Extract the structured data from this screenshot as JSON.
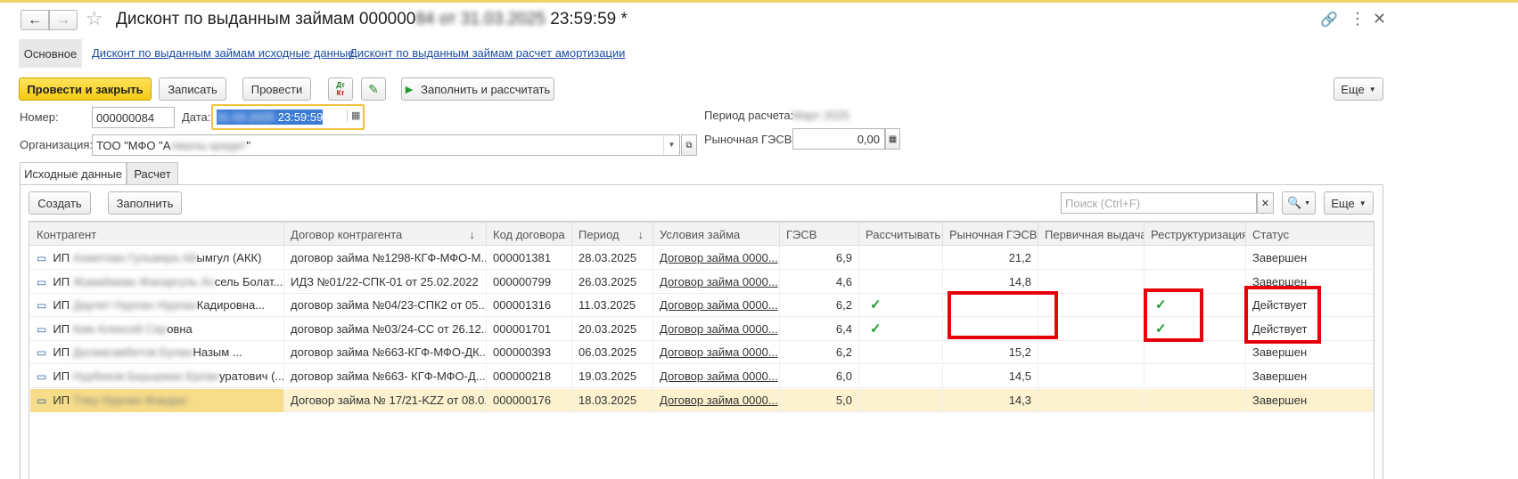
{
  "window": {
    "title_prefix": "Дисконт по выданным займам 000000",
    "title_blur": "84 от 31.03.2025",
    "title_suffix": " 23:59:59 *",
    "back_icon": "arrow-left-icon",
    "forward_icon": "arrow-right-icon",
    "star_icon": "star-icon",
    "link_icon": "link-icon",
    "more_icon": "kebab-icon",
    "close_icon": "close-icon"
  },
  "nav": {
    "main": "Основное",
    "link1": "Дисконт по выданным займам исходные данные",
    "link2": "Дисконт по выданным займам расчет амортизации"
  },
  "toolbar": {
    "post_close": "Провести и закрыть",
    "save": "Записать",
    "post": "Провести",
    "dtkt": "Дт Кт",
    "fill_calc": "Заполнить и рассчитать",
    "more": "Еще"
  },
  "form": {
    "number_label": "Номер:",
    "number_value": "000000084",
    "date_label": "Дата:",
    "date_blur": "31.03.2025",
    "date_time": " 23:59:59",
    "org_label": "Организация:",
    "org_prefix": "ТОО \"МФО \"А",
    "org_blur": "лмалы кредит",
    "org_suffix": "\"",
    "period_label": "Период расчета:",
    "period_blur": "Март 2025",
    "market_label": "Рыночная ГЭСВ:",
    "market_value": "0,00"
  },
  "tabs": [
    "Исходные данные",
    "Расчет"
  ],
  "table_toolbar": {
    "create": "Создать",
    "fill": "Заполнить",
    "search_placeholder": "Поиск (Ctrl+F)",
    "more": "Еще"
  },
  "columns": [
    "Контрагент",
    "Договор контрагента",
    "Код договора",
    "Период",
    "Условия займа",
    "ГЭСВ",
    "Рассчитывать",
    "Рыночная ГЭСВ",
    "Первичная выдача",
    "Реструктуризация",
    "Статус"
  ],
  "rows": [
    {
      "c_pre": "ИП",
      "c_blur": "Ахметова Гульмира Ай",
      "c_post": "ымгул (АКК)",
      "contract": "договор займа №1298-КГФ-МФО-М...",
      "code": "000001381",
      "period": "28.03.2025",
      "terms": "Договор займа 0000...",
      "gesv": "6,9",
      "calc": "",
      "market": "21,2",
      "restr": "",
      "status": "Завершен"
    },
    {
      "c_pre": "ИП",
      "c_blur": "Жумабаева Жанаргуль Ас",
      "c_post": "сель Болат...",
      "contract": "ИДЗ №01/22-СПК-01  от 25.02.2022",
      "code": "000000799",
      "period": "26.03.2025",
      "terms": "Договор займа 0000...",
      "gesv": "4,6",
      "calc": "",
      "market": "14,8",
      "restr": "",
      "status": "Завершен"
    },
    {
      "c_pre": "ИП",
      "c_blur": "Даулет Нурлан Нурлан",
      "c_post": "Кадировна...",
      "contract": "договор займа №04/23-СПК2 от 05...",
      "code": "000001316",
      "period": "11.03.2025",
      "terms": "Договор займа 0000...",
      "gesv": "6,2",
      "calc": "✓",
      "market": "",
      "restr": "✓",
      "status": "Действует"
    },
    {
      "c_pre": "ИП",
      "c_blur": "Ким Алексей Сер",
      "c_post": "овна",
      "contract": "договор займа №03/24-СС от 26.12...",
      "code": "000001701",
      "period": "20.03.2025",
      "terms": "Договор займа 0000...",
      "gesv": "6,4",
      "calc": "✓",
      "market": "",
      "restr": "✓",
      "status": "Действует"
    },
    {
      "c_pre": "ИП",
      "c_blur": "Досмагамбетов Ерлан",
      "c_post": "Назым ...",
      "contract": "договор займа №663-КГФ-МФО-ДК...",
      "code": "000000393",
      "period": "06.03.2025",
      "terms": "Договор займа 0000...",
      "gesv": "6,2",
      "calc": "",
      "market": "15,2",
      "restr": "",
      "status": "Завершен"
    },
    {
      "c_pre": "ИП",
      "c_blur": "Нурбеков Бауыржан Ерлан",
      "c_post": "уратович (...",
      "contract": "договор займа №663- КГФ-МФО-Д...",
      "code": "000000218",
      "period": "19.03.2025",
      "terms": "Договор займа 0000...",
      "gesv": "6,0",
      "calc": "",
      "market": "14,5",
      "restr": "",
      "status": "Завершен"
    },
    {
      "c_pre": "ИП",
      "c_blur": "Тлеу Нурлан Жандос",
      "c_post": "",
      "contract": "Договор займа № 17/21-KZZ от 08.0...",
      "code": "000000176",
      "period": "18.03.2025",
      "terms": "Договор займа 0000...",
      "gesv": "5,0",
      "calc": "",
      "market": "14,3",
      "restr": "",
      "status": "Завершен"
    }
  ]
}
